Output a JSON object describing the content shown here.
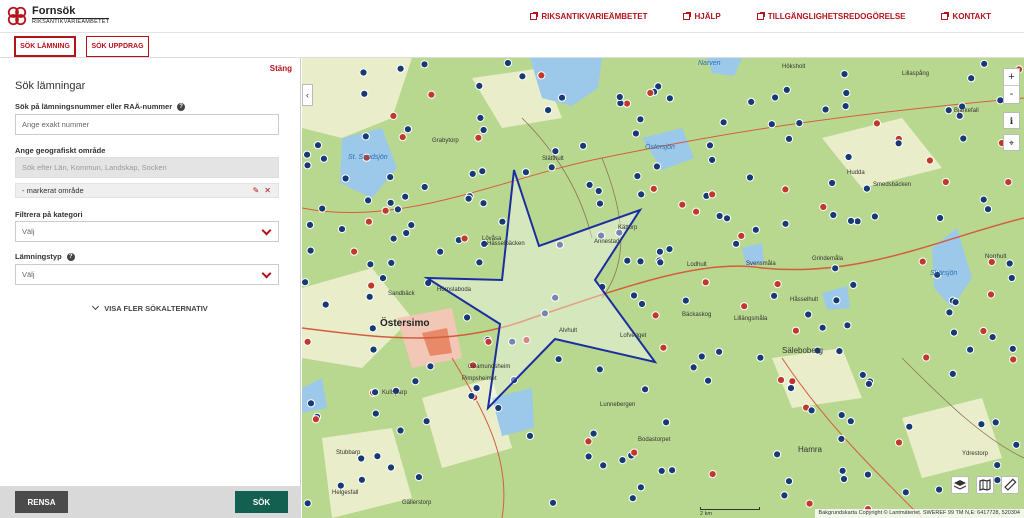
{
  "header": {
    "logo_title": "Fornsök",
    "logo_subtitle": "RIKSANTIKVARIEÄMBETET",
    "nav": [
      "RIKSANTIKVARIEÄMBETET",
      "HJÄLP",
      "TILLGÄNGLIGHETSREDOGÖRELSE",
      "KONTAKT"
    ]
  },
  "tabs": [
    "SÖK LÄMNING",
    "SÖK UPPDRAG"
  ],
  "panel": {
    "close_label": "Stäng",
    "title": "Sök lämningar",
    "number_label": "Sök på lämningsnummer eller RAÄ-nummer",
    "number_placeholder": "Ange exakt nummer",
    "geo_label": "Ange geografiskt område",
    "geo_placeholder": "Sök efter Län, Kommun, Landskap, Socken",
    "selected_area": "- markerat område",
    "category_label": "Filtrera på kategori",
    "category_value": "Välj",
    "type_label": "Lämningstyp",
    "type_value": "Välj",
    "more_label": "VISA FLER SÖKALTERNATIV",
    "reset_label": "RENSA",
    "search_label": "SÖK"
  },
  "map": {
    "zoom_in": "+",
    "zoom_out": "-",
    "scale_label": "2 km",
    "attribution": "Bakgrundskarta Copyright © Lantmäteriet. SWEREF 99 TM N,E:",
    "coordinates": "6417728, 520304",
    "town_label": "Östersimo",
    "lake_labels": [
      "St. Sundsjön",
      "Östersjön",
      "Skärsjön",
      "Narven"
    ],
    "place_labels": [
      "Hässelbäcken",
      "Hörnslaboda",
      "Kättorp",
      "Slätthult",
      "Lövåsa",
      "Annestad",
      "Lodhult",
      "Svensmåla",
      "Grindemåla",
      "Håsselhult",
      "Bäckaskog",
      "Lillängsmåla",
      "Säleboberg",
      "Guamundsheim",
      "Pimpsheimet",
      "Lunnebergen",
      "Bodastorpet",
      "Stubbarp",
      "Helgesfall",
      "Gällerstorp",
      "Hamra",
      "Ydrestorp",
      "Höksholt",
      "Bjärkefall",
      "Norrhult",
      "Hudda",
      "Smedsbäcken",
      "Grabytorp",
      "Lillaspång",
      "Sandbäck",
      "Alvhult",
      "Lofveriget",
      "Kullsparp"
    ]
  }
}
